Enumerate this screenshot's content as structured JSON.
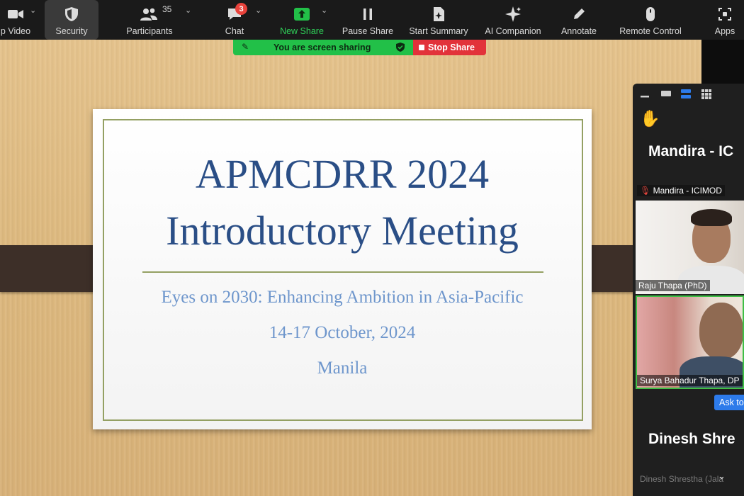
{
  "toolbar": {
    "items": [
      {
        "label": "p Video",
        "icon": "video-camera-icon"
      },
      {
        "label": "Security",
        "icon": "shield-icon"
      },
      {
        "label": "Participants",
        "icon": "participants-icon"
      },
      {
        "label": "Chat",
        "icon": "chat-bubble-icon"
      },
      {
        "label": "New Share",
        "icon": "share-arrow-icon"
      },
      {
        "label": "Pause Share",
        "icon": "pause-icon"
      },
      {
        "label": "Start Summary",
        "icon": "summary-icon"
      },
      {
        "label": "AI Companion",
        "icon": "sparkle-icon"
      },
      {
        "label": "Annotate",
        "icon": "pencil-icon"
      },
      {
        "label": "Remote Control",
        "icon": "mouse-icon"
      },
      {
        "label": "Apps",
        "icon": "apps-icon"
      }
    ],
    "participant_count": "35",
    "chat_badge": "3"
  },
  "share_banner": {
    "sharing_text": "You are screen sharing",
    "stop_label": "Stop Share",
    "colors": {
      "green": "#22c048",
      "red": "#e2323a"
    }
  },
  "slide": {
    "title_line1": "APMCDRR 2024",
    "title_line2": "Introductory Meeting",
    "subtitle": "Eyes on 2030: Enhancing Ambition in Asia-Pacific",
    "dates": "14-17 October, 2024",
    "location": "Manila",
    "colors": {
      "title": "#2a4e86",
      "subtitle": "#6e96cc",
      "accent": "#94a063"
    }
  },
  "panel": {
    "speaker_name": "Mandira  -  IC",
    "tiles": [
      {
        "label": "Mandira - ICIMOD",
        "muted": true
      },
      {
        "label": "Raju Thapa (PhD)"
      },
      {
        "label": "Surya Bahadur Thapa, DP"
      }
    ],
    "ask_button": "Ask to",
    "bottom_name": "Dinesh  Shre",
    "bottom_label": "Dinesh Shrestha (Jala",
    "icons": [
      "minimize-icon",
      "speaker-view-icon",
      "filmstrip-icon",
      "gallery-grid-icon",
      "raised-hand-icon"
    ]
  }
}
